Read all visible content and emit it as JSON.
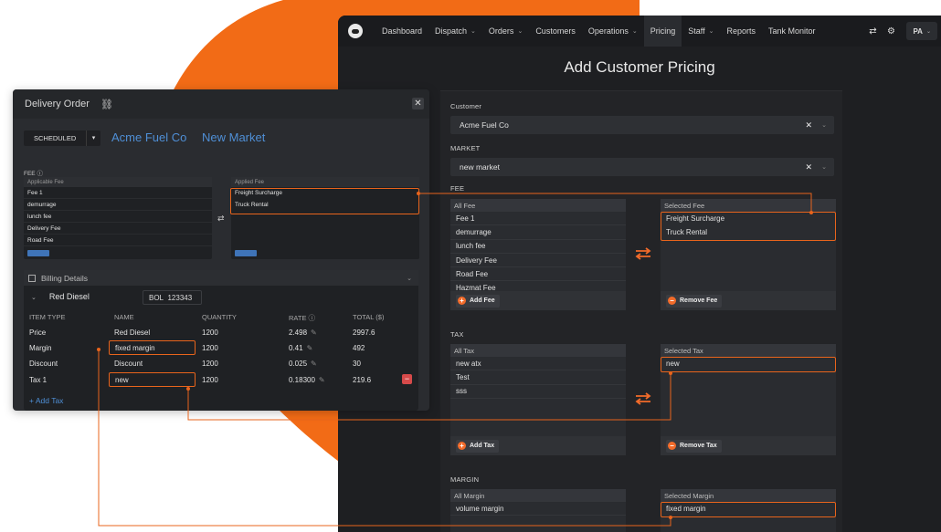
{
  "colors": {
    "accent": "#f26b2a",
    "link_blue": "#4f8fd6",
    "dark_bg": "#1e1f22",
    "connector": "#e8641c"
  },
  "nav": {
    "items": [
      {
        "label": "Dashboard"
      },
      {
        "label": "Dispatch",
        "caret": "⌄"
      },
      {
        "label": "Orders",
        "caret": "⌄"
      },
      {
        "label": "Customers"
      },
      {
        "label": "Operations",
        "caret": "⌄"
      },
      {
        "label": "Pricing",
        "active": true
      },
      {
        "label": "Staff",
        "caret": "⌄"
      },
      {
        "label": "Reports"
      },
      {
        "label": "Tank Monitor"
      }
    ],
    "swap_icon": "⇄",
    "gear_icon": "⚙",
    "user_initials": "PA",
    "user_caret": "⌄"
  },
  "pricing": {
    "title": "Add Customer Pricing",
    "customer_label": "Customer",
    "customer_value": "Acme Fuel Co",
    "market_label": "MARKET",
    "market_value": "new market",
    "clear_symbol": "✕",
    "dropdown_symbol": "⌄",
    "fee": {
      "section_label": "FEE",
      "all_header": "All Fee",
      "all_items": [
        "Fee 1",
        "demurrage",
        "lunch fee",
        "Delivery Fee",
        "Road Fee",
        "Hazmat Fee"
      ],
      "selected_header": "Selected Fee",
      "selected_items": [
        "Freight Surcharge",
        "Truck Rental"
      ],
      "add_label": "Add Fee",
      "remove_label": "Remove Fee"
    },
    "tax": {
      "section_label": "TAX",
      "all_header": "All Tax",
      "all_items": [
        "new atx",
        "Test",
        "sss"
      ],
      "selected_header": "Selected Tax",
      "selected_items": [
        "new"
      ],
      "add_label": "Add Tax",
      "remove_label": "Remove Tax"
    },
    "margin": {
      "section_label": "MARGIN",
      "all_header": "All Margin",
      "all_items": [
        "volume margin"
      ],
      "selected_header": "Selected Margin",
      "selected_items": [
        "fixed margin"
      ]
    }
  },
  "delivery": {
    "title": "Delivery Order",
    "link_icon": "⛓",
    "close_symbol": "✕",
    "status": "SCHEDULED",
    "status_caret": "▾",
    "customer": "Acme Fuel Co",
    "market": "New Market",
    "fee_label": "FEE",
    "info_icon": "ⓘ",
    "applicable_header": "Applicable Fee",
    "applicable_items": [
      "Fee 1",
      "demurrage",
      "lunch fee",
      "Delivery Fee",
      "Road Fee"
    ],
    "applied_header": "Applied Fee",
    "applied_items": [
      "Freight Surcharge",
      "Truck Rental"
    ],
    "swap_symbol": "⇄",
    "billing": {
      "title": "Billing Details",
      "collapse_symbol": "⌄",
      "product_caret": "⌄",
      "product": "Red Diesel",
      "bol_label": "BOL",
      "bol_value": "123343",
      "headers": {
        "type": "ITEM TYPE",
        "name": "NAME",
        "qty": "QUANTITY",
        "rate": "RATE",
        "total": "TOTAL ($)"
      },
      "rows": [
        {
          "type": "Price",
          "name": "Red Diesel",
          "qty": "1200",
          "rate": "2.498",
          "total": "2997.6"
        },
        {
          "type": "Margin",
          "name": "fixed margin",
          "qty": "1200",
          "rate": "0.41",
          "total": "492"
        },
        {
          "type": "Discount",
          "name": "Discount",
          "qty": "1200",
          "rate": "0.025",
          "total": "30"
        },
        {
          "type": "Tax 1",
          "name": "new",
          "qty": "1200",
          "rate": "0.18300",
          "total": "219.6"
        }
      ],
      "add_tax": "+ Add Tax",
      "delete_symbol": "−",
      "pencil_symbol": "✎"
    }
  }
}
